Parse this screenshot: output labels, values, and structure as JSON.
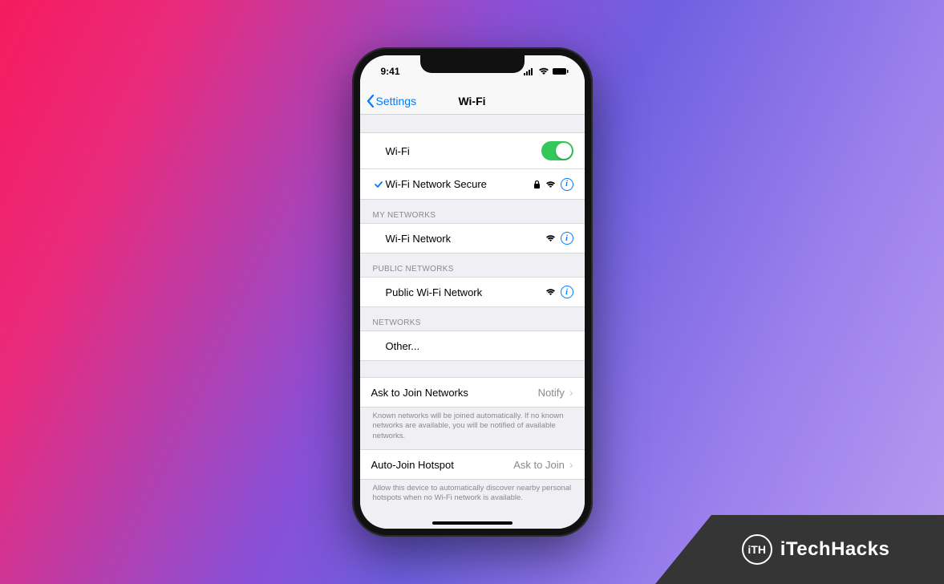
{
  "status": {
    "time": "9:41"
  },
  "nav": {
    "back": "Settings",
    "title": "Wi-Fi"
  },
  "wifi": {
    "toggle_label": "Wi-Fi",
    "toggle_on": true,
    "connected": {
      "name": "Wi-Fi Network Secure",
      "secure": true
    }
  },
  "sections": {
    "my": {
      "header": "MY NETWORKS",
      "items": [
        {
          "name": "Wi-Fi Network",
          "secure": false
        }
      ]
    },
    "public": {
      "header": "PUBLIC NETWORKS",
      "items": [
        {
          "name": "Public Wi-Fi Network",
          "secure": false
        }
      ]
    },
    "other": {
      "header": "NETWORKS",
      "other_label": "Other..."
    }
  },
  "ask_join": {
    "label": "Ask to Join Networks",
    "value": "Notify",
    "footer": "Known networks will be joined automatically. If no known networks are available, you will be notified of available networks."
  },
  "auto_join": {
    "label": "Auto-Join Hotspot",
    "value": "Ask to Join",
    "footer": "Allow this device to automatically discover nearby personal hotspots when no Wi-Fi network is available."
  },
  "watermark": {
    "logo": "iTH",
    "text": "iTechHacks"
  }
}
